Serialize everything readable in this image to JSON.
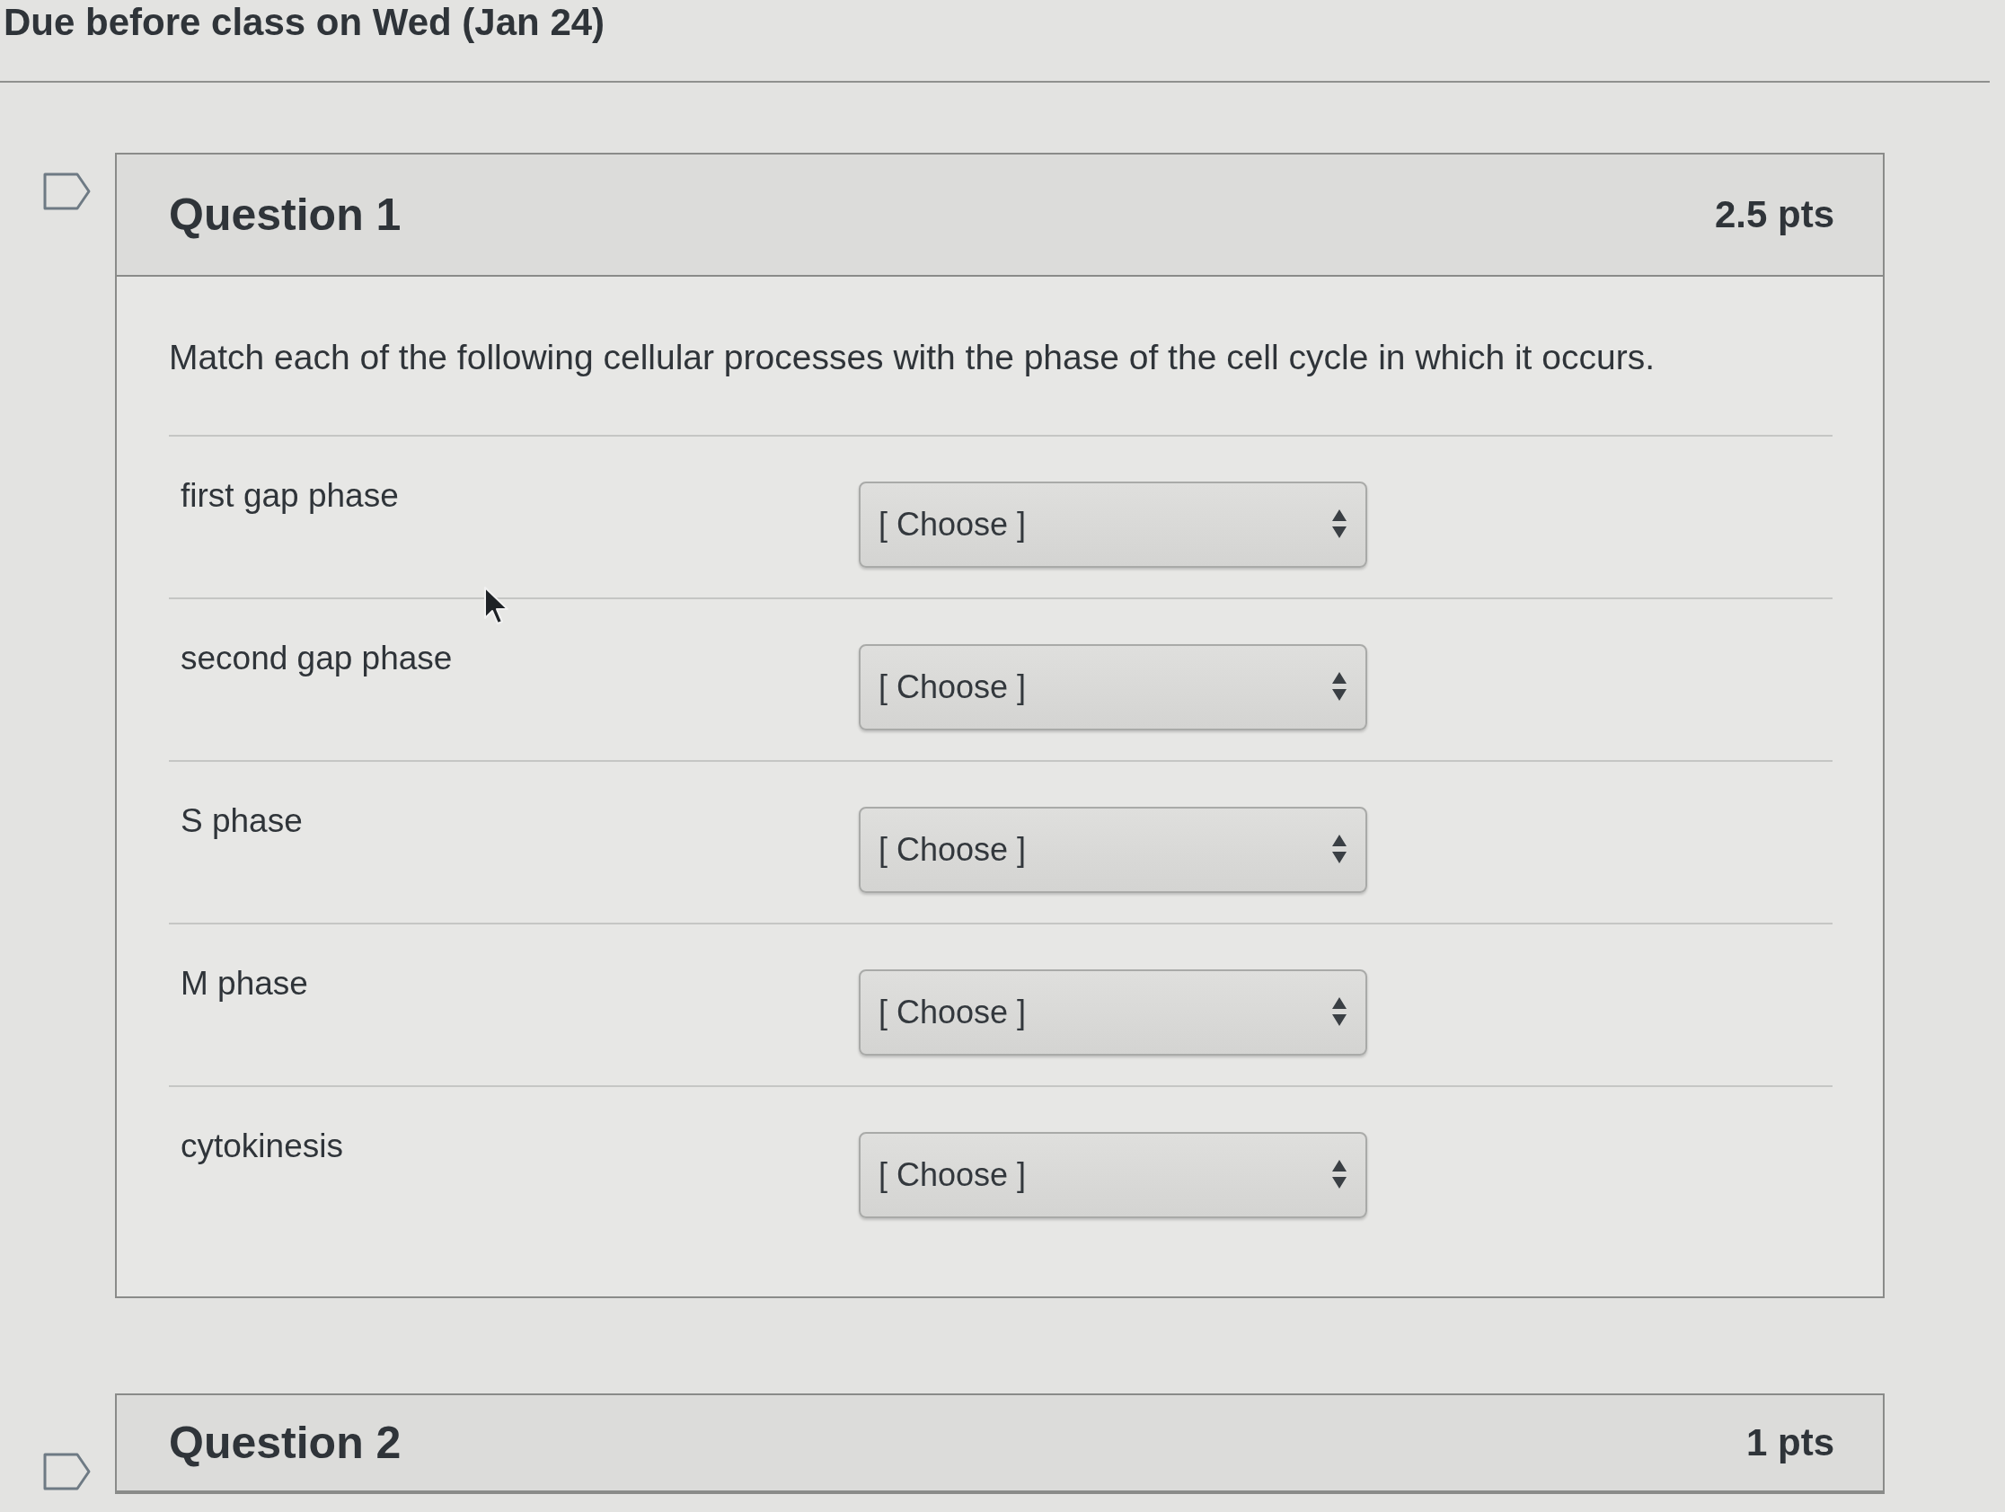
{
  "assignment": {
    "due_text": "Due before class on Wed (Jan 24)"
  },
  "questions": [
    {
      "title": "Question 1",
      "points": "2.5 pts",
      "flagged": false,
      "prompt": "Match each of the following cellular processes with the phase of the cell cycle in which it occurs.",
      "matches": [
        {
          "label": "first gap phase",
          "value": "[ Choose ]"
        },
        {
          "label": "second gap phase",
          "value": "[ Choose ]"
        },
        {
          "label": "S phase",
          "value": "[ Choose ]"
        },
        {
          "label": "M phase",
          "value": "[ Choose ]"
        },
        {
          "label": "cytokinesis",
          "value": "[ Choose ]"
        }
      ]
    },
    {
      "title": "Question 2",
      "points": "1 pts",
      "flagged": false
    }
  ]
}
